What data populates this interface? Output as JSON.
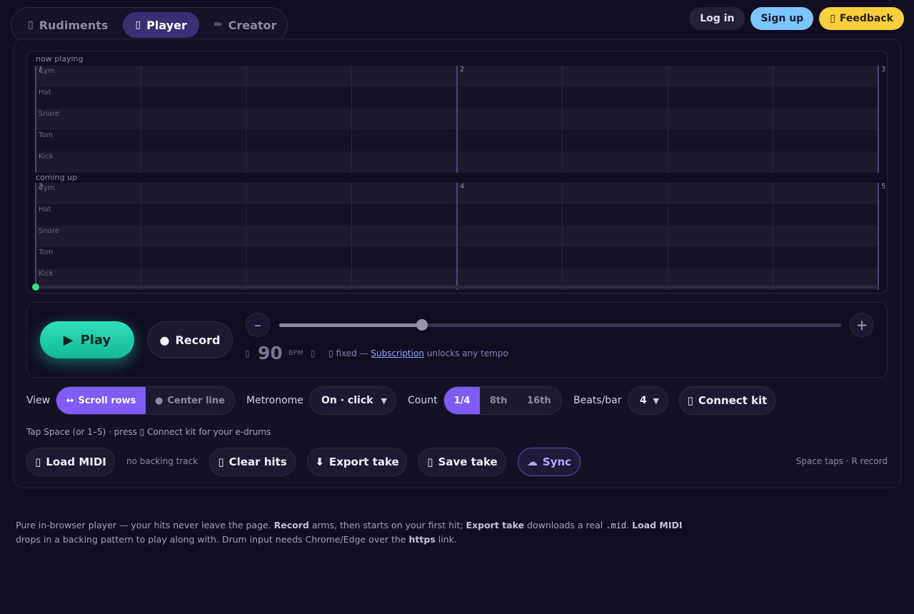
{
  "nav": {
    "tabs": [
      {
        "icon": "▯",
        "label": "Rudiments"
      },
      {
        "icon": "▯",
        "label": "Player"
      },
      {
        "icon": "✏",
        "label": "Creator"
      }
    ],
    "active": "Player"
  },
  "auth": {
    "login": "Log in",
    "signup": "Sign up",
    "feedback_icon": "▯",
    "feedback": "Feedback"
  },
  "grid": {
    "now_label": "now playing",
    "next_label": "coming up",
    "lanes": [
      "Cym",
      "Hat",
      "Snare",
      "Tom",
      "Kick"
    ],
    "now_bars": [
      "1",
      "2",
      "3"
    ],
    "next_bars": [
      "3",
      "4",
      "5"
    ]
  },
  "transport": {
    "play_icon": "▶",
    "play": "Play",
    "record_icon": "●",
    "record": "Record",
    "minus": "–",
    "plus": "+",
    "tempo_fraction": 0.254,
    "lock_icon": "▯",
    "bpm": "90",
    "bpm_unit": "BPM",
    "bpm_icon2": "▯",
    "note_icon": "▯",
    "note_fixed": "fixed — ",
    "note_link": "Subscription",
    "note_rest": " unlocks any tempo"
  },
  "controls": {
    "view_label": "View",
    "view_opts": [
      {
        "icon": "↔",
        "label": "Scroll rows"
      },
      {
        "icon": "●",
        "label": "Center line"
      }
    ],
    "metronome_label": "Metronome",
    "metronome_value": "On · click",
    "count_label": "Count",
    "count_opts": [
      "1/4",
      "8th",
      "16th"
    ],
    "beats_label": "Beats/bar",
    "beats_value": "4",
    "connect_icon": "▯",
    "connect": "Connect kit"
  },
  "hint": {
    "pre": "Tap Space (or 1–5) · press ",
    "icon": "▯",
    "post": " Connect kit for your e-drums"
  },
  "actions": {
    "load_icon": "▯",
    "load": "Load MIDI",
    "no_backing": "no backing track",
    "clear_icon": "▯",
    "clear": "Clear hits",
    "export_icon": "⬇",
    "export": "Export take",
    "save_icon": "▯",
    "save": "Save take",
    "sync_icon": "☁",
    "sync": "Sync",
    "shortcuts": "Space taps · R record"
  },
  "footer": {
    "t1": "Pure in-browser player — your hits never leave the page. ",
    "b1": "Record",
    "t2": " arms, then starts on your first hit; ",
    "b2": "Export take",
    "t3": " downloads a real ",
    "code": ".mid",
    "t4": ". ",
    "b3": "Load MIDI",
    "t5": " drops in a backing pattern to play along with. Drum input needs Chrome/Edge over the ",
    "b4": "https",
    "t6": " link."
  },
  "colors": {
    "accent": "#7f5cf5",
    "play": "#1fd1ad",
    "signup": "#7cc6ff",
    "feedback": "#f8cf3d",
    "bar_line": "#5b57a0",
    "playhead": "#36e07a"
  }
}
